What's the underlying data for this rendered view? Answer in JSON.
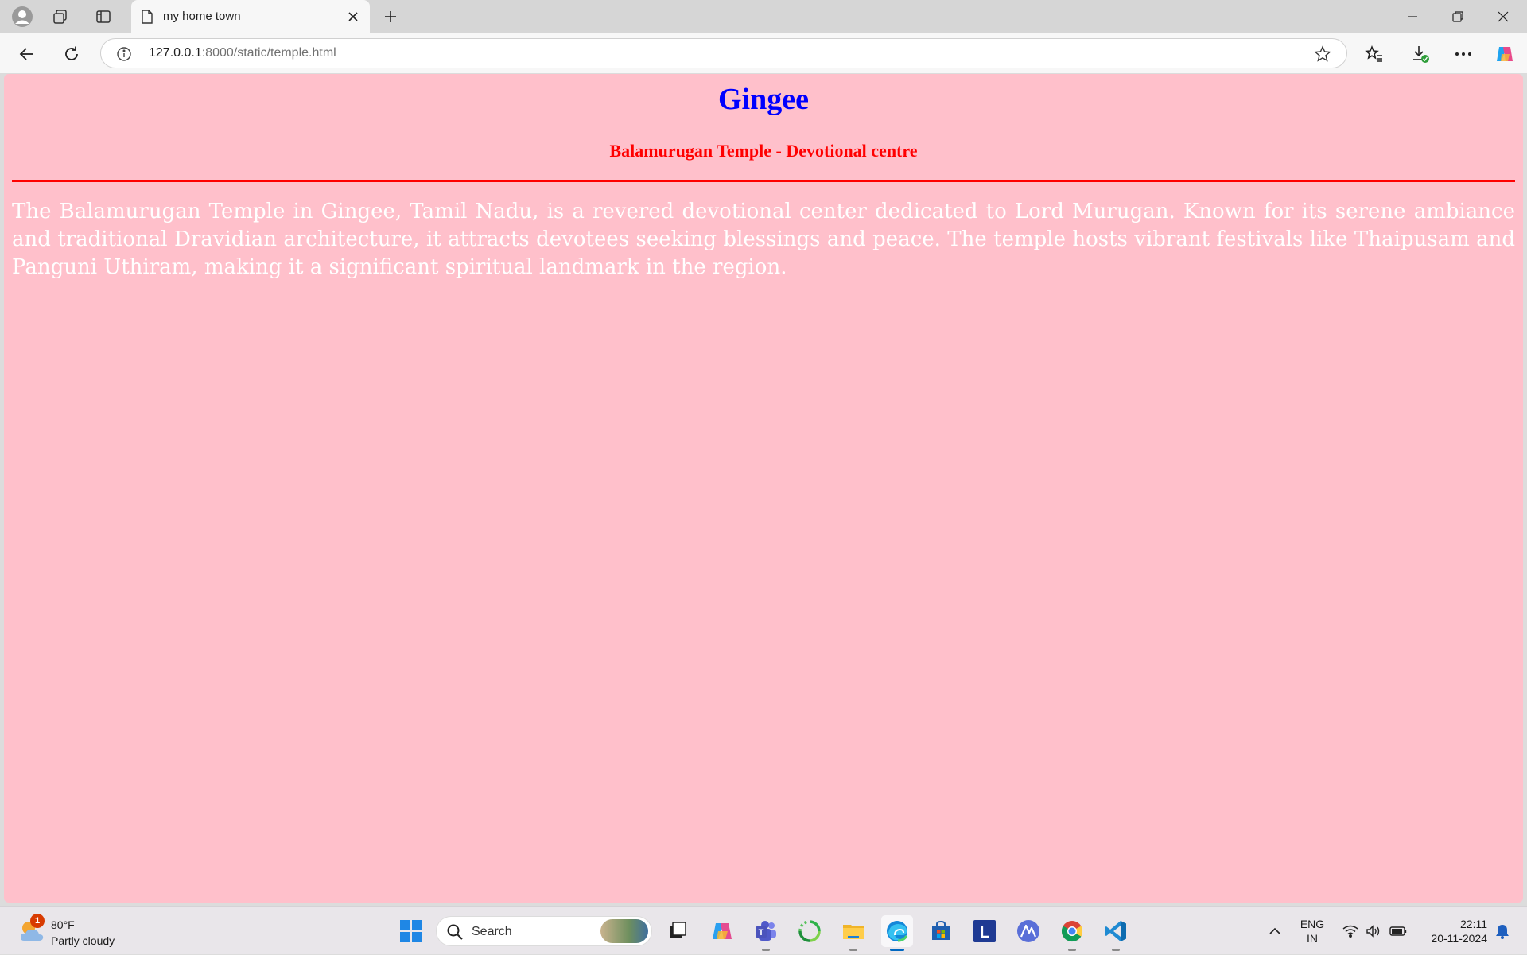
{
  "browser": {
    "tab_title": "my home town",
    "url_host": "127.0.0.1",
    "url_rest": ":8000/static/temple.html"
  },
  "page": {
    "heading": "Gingee",
    "subheading": "Balamurugan Temple - Devotional centre",
    "body": "The Balamurugan Temple in Gingee, Tamil Nadu, is a revered devotional center dedicated to Lord Murugan. Known for its serene ambiance and traditional Dravidian architecture, it attracts devotees seeking blessings and peace. The temple hosts vibrant festivals like Thaipusam and Panguni Uthiram, making it a significant spiritual landmark in the region.",
    "colors": {
      "background": "#ffc0cb",
      "heading": "#0000ff",
      "subheading": "#ff0000",
      "rule": "#ff0000",
      "body_text": "#ffffff"
    }
  },
  "taskbar": {
    "weather_temp": "80°F",
    "weather_condition": "Partly cloudy",
    "weather_badge": "1",
    "search_placeholder": "Search",
    "lang_line1": "ENG",
    "lang_line2": "IN",
    "time": "22:11",
    "date": "20-11-2024",
    "pinned_icons": [
      "start-icon",
      "search-box",
      "task-view-icon",
      "copilot-icon",
      "teams-icon",
      "loader-app-icon",
      "file-explorer-icon",
      "edge-icon",
      "store-icon",
      "l-app-icon",
      "ai-app-icon",
      "chrome-icon",
      "vscode-icon"
    ]
  }
}
